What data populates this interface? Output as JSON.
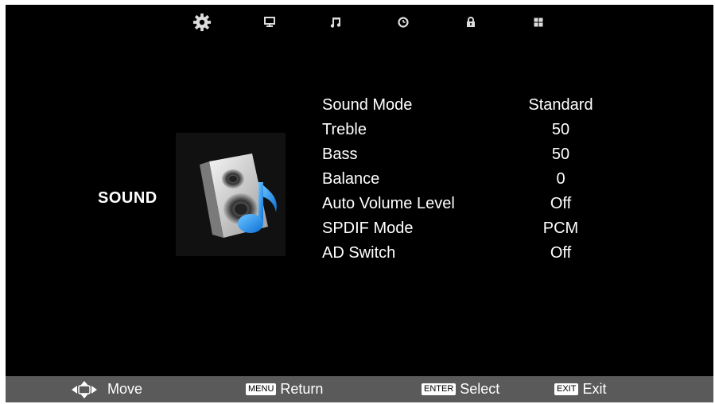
{
  "tabs": [
    {
      "icon": "gear-icon",
      "name": "Picture"
    },
    {
      "icon": "monitor-icon",
      "name": "Screen"
    },
    {
      "icon": "music-note-icon",
      "name": "Sound"
    },
    {
      "icon": "clock-icon",
      "name": "Time"
    },
    {
      "icon": "lock-icon",
      "name": "Lock"
    },
    {
      "icon": "grid-icon",
      "name": "Setup"
    }
  ],
  "page": {
    "title": "SOUND"
  },
  "menu": {
    "items": [
      {
        "label": "Sound Mode",
        "value": "Standard"
      },
      {
        "label": "Treble",
        "value": "50"
      },
      {
        "label": "Bass",
        "value": "50"
      },
      {
        "label": "Balance",
        "value": "0"
      },
      {
        "label": "Auto Volume Level",
        "value": "Off"
      },
      {
        "label": "SPDIF Mode",
        "value": "PCM"
      },
      {
        "label": "AD Switch",
        "value": "Off"
      }
    ]
  },
  "footer": {
    "move": {
      "label": "Move"
    },
    "return": {
      "key": "MENU",
      "label": "Return"
    },
    "select": {
      "key": "ENTER",
      "label": "Select"
    },
    "exit": {
      "key": "EXIT",
      "label": "Exit"
    }
  },
  "colors": {
    "background": "#000000",
    "footer": "#5a5a5a",
    "text": "#ffffff",
    "accent": "#1e90ff"
  }
}
